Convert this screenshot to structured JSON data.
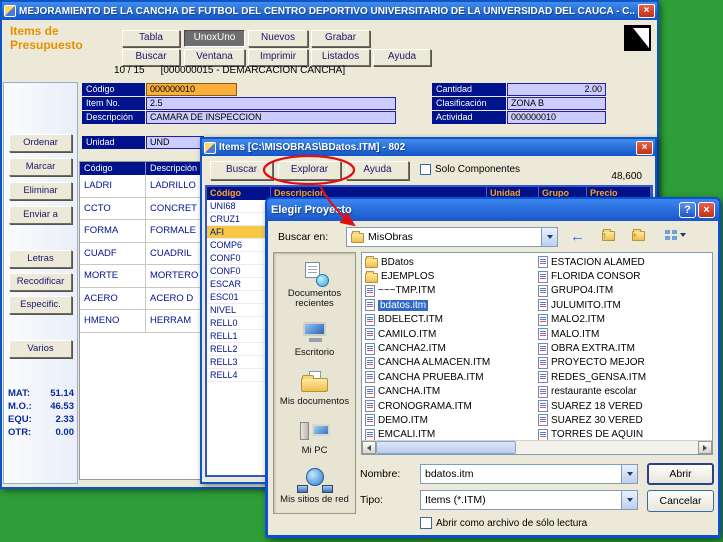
{
  "icons": {
    "close": "×",
    "help": "?",
    "back": "←",
    "up": "↑",
    "new_folder": "+"
  },
  "colors": {
    "desktop_green": "#2E9E38",
    "navy": "#00128C",
    "header_orange": "#FFA41E",
    "selection_blue": "#316AC5",
    "field_lavender": "#CCCCFF",
    "field_orange": "#FCAE3A",
    "annotation_red": "#E01010"
  },
  "main_window": {
    "title": "MEJORAMIENTO DE LA CANCHA DE FUTBOL DEL CENTRO DEPORTIVO UNIVERSITARIO DE LA UNIVERSIDAD DEL CAUCA - C...",
    "app_title": {
      "line1": "Items de",
      "line2": "Presupuesto"
    },
    "toolbar": {
      "tabla": "Tabla",
      "unoxuno": "UnoxUno",
      "nuevos": "Nuevos",
      "grabar": "Grabar",
      "buscar": "Buscar",
      "ventana": "Ventana",
      "imprimir": "Imprimir",
      "listados": "Listados",
      "ayuda": "Ayuda"
    },
    "status": {
      "count": "10 / 15",
      "detail": "[000000015 - DEMARCACION CANCHA]"
    },
    "form": {
      "codigo_label": "Código",
      "codigo_value": "000000010",
      "item_label": "Item No.",
      "item_value": "2.5",
      "desc_label": "Descripción",
      "desc_value": "CAMARA DE INSPECCION",
      "unidad_label": "Unidad",
      "unidad_value": "UND",
      "cantidad_label": "Cantidad",
      "cantidad_value": "2.00",
      "clasif_label": "Clasificación",
      "clasif_value": "ZONA B",
      "activ_label": "Actividad",
      "activ_value": "000000010"
    },
    "sidebar": {
      "buttons": [
        "Ordenar",
        "Marcar",
        "Eliminar",
        "Enviar a",
        "Letras",
        "Recodificar",
        "Especific.",
        "Varios"
      ]
    },
    "stats": [
      {
        "label": "MAT:",
        "value": "51.14"
      },
      {
        "label": "M.O.:",
        "value": "46.53"
      },
      {
        "label": "EQU:",
        "value": "2.33"
      },
      {
        "label": "OTR:",
        "value": "0.00"
      }
    ],
    "table": {
      "headers": [
        "Código",
        "Descripción"
      ],
      "rows": [
        [
          "LADRI",
          "LADRILLO"
        ],
        [
          "CCTO",
          "CONCRET"
        ],
        [
          "FORMA",
          "FORMALE"
        ],
        [
          "CUADF",
          "CUADRIL"
        ],
        [
          "MORTE",
          "MORTERO"
        ],
        [
          "ACERO",
          "ACERO D"
        ],
        [
          "HMENO",
          "HERRAM"
        ]
      ]
    }
  },
  "items_window": {
    "title": "Items  [C:\\MISOBRAS\\BDatos.ITM] - 802",
    "buttons": {
      "buscar": "Buscar",
      "explorar": "Explorar",
      "ayuda": "Ayuda"
    },
    "checkbox_label": "Solo Componentes",
    "price_value": "48,600",
    "headers": [
      "Código",
      "Descripcion",
      "Unidad",
      "Grupo",
      "Precio"
    ],
    "codes": [
      "UNI68",
      "CRUZ1",
      "AFI",
      "COMP6",
      "CONF0",
      "CONF0",
      "ESCAR",
      "ESC01",
      "NIVEL",
      "RELL0",
      "RELL1",
      "RELL2",
      "RELL3",
      "RELL4"
    ]
  },
  "file_dialog": {
    "title": "Elegir Proyecto",
    "look_in_label": "Buscar en:",
    "look_in_value": "MisObras",
    "places": [
      "Documentos recientes",
      "Escritorio",
      "Mis documentos",
      "Mi PC",
      "Mis sitios de red"
    ],
    "files_col1": [
      "BDatos",
      "EJEMPLOS",
      "~~~TMP.ITM",
      "bdatos.itm",
      "BDELECT.ITM",
      "CAMILO.ITM",
      "CANCHA2.ITM",
      "CANCHA ALMACEN.ITM",
      "CANCHA PRUEBA.ITM",
      "CANCHA.ITM",
      "CRONOGRAMA.ITM",
      "DEMO.ITM",
      "EMCALI.ITM"
    ],
    "files_col2": [
      "ESTACION ALAMED",
      "FLORIDA CONSOR",
      "GRUPO4.ITM",
      "JULUMITO.ITM",
      "MALO2.ITM",
      "MALO.ITM",
      "OBRA EXTRA.ITM",
      "PROYECTO MEJOR",
      "REDES_GENSA.ITM",
      "restaurante escolar",
      "SUAREZ 18 VERED",
      "SUAREZ 30 VERED",
      "TORRES DE AQUIN"
    ],
    "filename_label": "Nombre:",
    "filename_value": "bdatos.itm",
    "filetype_label": "Tipo:",
    "filetype_value": "Items (*.ITM)",
    "open_label": "Abrir",
    "cancel_label": "Cancelar",
    "readonly_label": "Abrir como archivo de sólo lectura"
  }
}
